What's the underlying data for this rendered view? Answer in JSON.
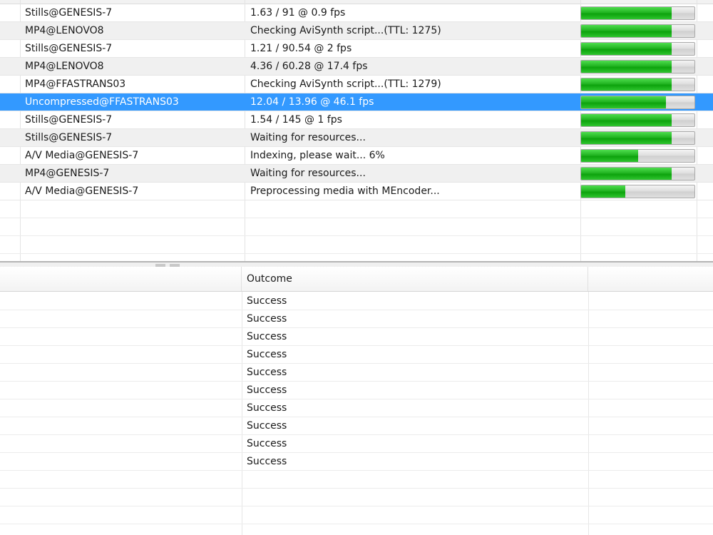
{
  "jobs": {
    "rows": [
      {
        "name": "Stills@GENESIS-7",
        "status": "1.63 / 91 @ 0.9 fps",
        "progress": 0.8
      },
      {
        "name": "MP4@LENOVO8",
        "status": "Checking AviSynth script...(TTL: 1275)",
        "progress": 0.8
      },
      {
        "name": "Stills@GENESIS-7",
        "status": "1.21 / 90.54 @ 2 fps",
        "progress": 0.8
      },
      {
        "name": "MP4@LENOVO8",
        "status": "4.36 / 60.28 @ 17.4 fps",
        "progress": 0.8
      },
      {
        "name": "MP4@FFASTRANS03",
        "status": "Checking AviSynth script...(TTL: 1279)",
        "progress": 0.8
      },
      {
        "name": "Uncompressed@FFASTRANS03",
        "status": "12.04 / 13.96 @ 46.1 fps",
        "progress": 0.75,
        "selected": true
      },
      {
        "name": "Stills@GENESIS-7",
        "status": "1.54 / 145 @ 1 fps",
        "progress": 0.8
      },
      {
        "name": "Stills@GENESIS-7",
        "status": "Waiting for resources...",
        "progress": 0.8
      },
      {
        "name": "A/V Media@GENESIS-7",
        "status": "Indexing, please wait... 6%",
        "progress": 0.5
      },
      {
        "name": "MP4@GENESIS-7",
        "status": "Waiting for resources...",
        "progress": 0.8
      },
      {
        "name": "A/V Media@GENESIS-7",
        "status": "Preprocessing media with MEncoder...",
        "progress": 0.39
      }
    ]
  },
  "history": {
    "outcome_header": "Outcome",
    "rows": [
      "Success",
      "Success",
      "Success",
      "Success",
      "Success",
      "Success",
      "Success",
      "Success",
      "Success",
      "Success"
    ]
  },
  "colors": {
    "selection": "#3399ff",
    "progress_fill": "#1fb41f",
    "alt_row": "#f0f0f0"
  }
}
